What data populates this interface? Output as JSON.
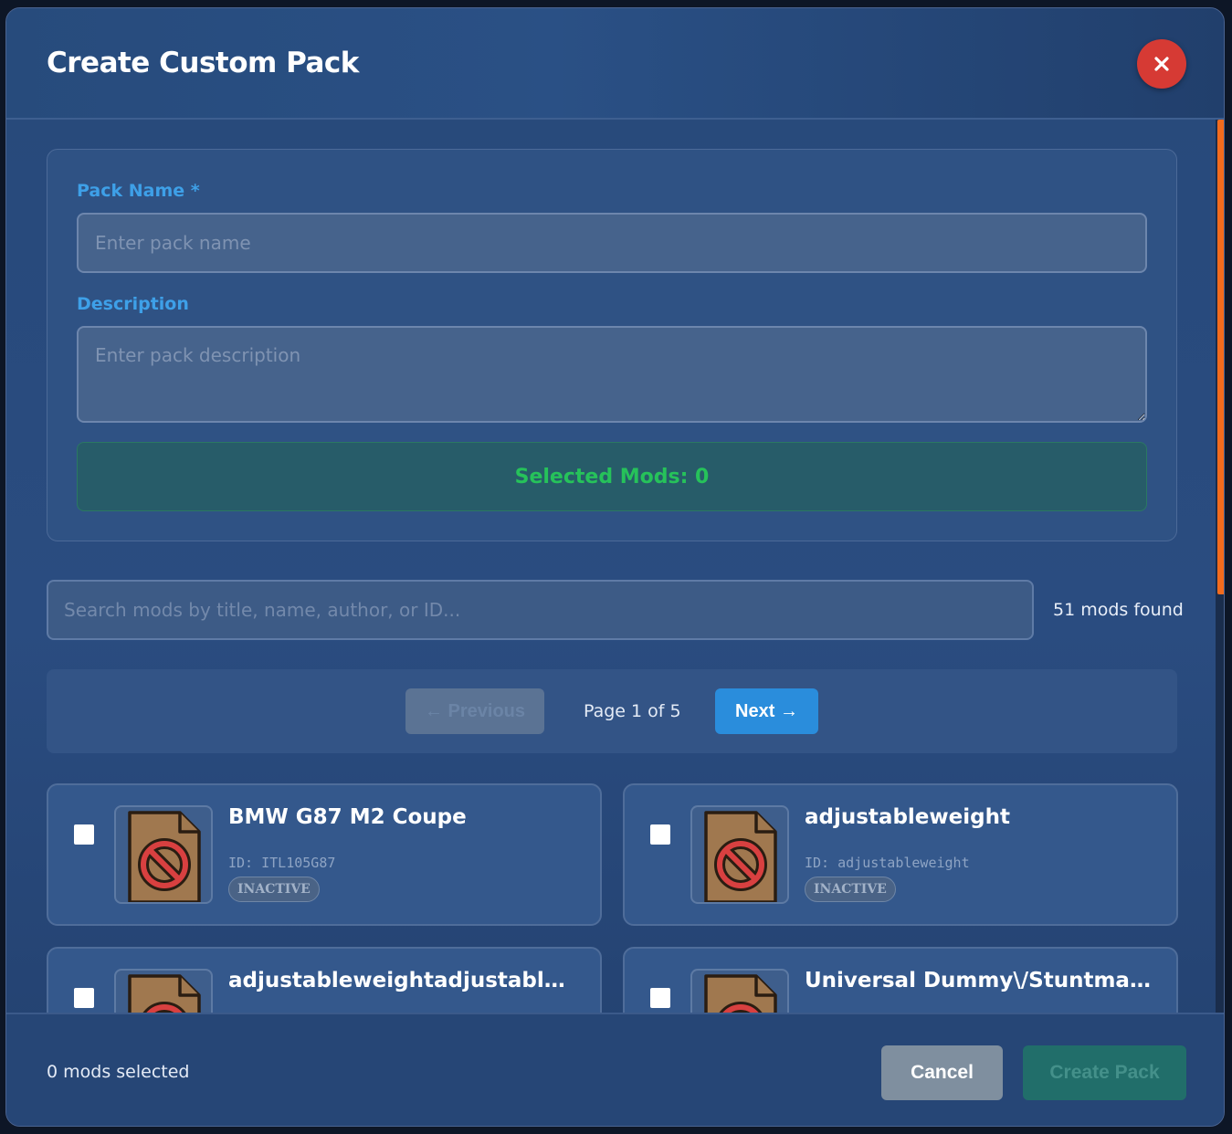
{
  "modal": {
    "title": "Create Custom Pack",
    "close_icon": "close-icon"
  },
  "form": {
    "pack_name_label": "Pack Name *",
    "pack_name_value": "",
    "pack_name_placeholder": "Enter pack name",
    "description_label": "Description",
    "description_value": "",
    "description_placeholder": "Enter pack description",
    "selected_mods_text": "Selected Mods: 0"
  },
  "search": {
    "placeholder": "Search mods by title, name, author, or ID...",
    "value": "",
    "results_count": "51 mods found"
  },
  "pagination": {
    "prev_label": "← Previous",
    "page_text": "Page 1 of 5",
    "next_label": "Next →"
  },
  "mods": [
    {
      "title": "BMW G87 M2 Coupe",
      "id_text": "ID: ITL105G87",
      "status": "INACTIVE",
      "checked": false,
      "icon": "disabled-file-icon"
    },
    {
      "title": "adjustableweight",
      "id_text": "ID: adjustableweight",
      "status": "INACTIVE",
      "checked": false,
      "icon": "disabled-file-icon"
    },
    {
      "title": "adjustableweightadjustablera...",
      "checked": false,
      "icon": "disabled-file-icon"
    },
    {
      "title": "Universal Dummy\\/Stuntman ...",
      "checked": false,
      "icon": "disabled-file-icon"
    }
  ],
  "footer": {
    "status_text": "0 mods selected",
    "cancel_label": "Cancel",
    "create_label": "Create Pack"
  },
  "colors": {
    "accent_blue": "#2a8ddc",
    "close_red": "#d63a34",
    "success_green": "#26c25a",
    "scroll_orange": "#f26b1d"
  }
}
